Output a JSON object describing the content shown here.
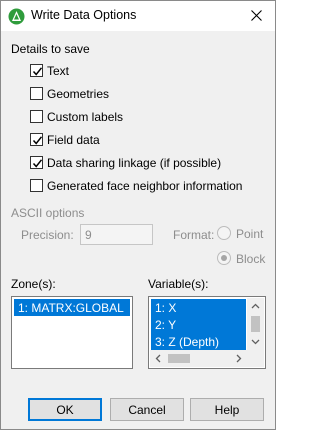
{
  "window": {
    "title": "Write Data Options",
    "icons": {
      "app": "tecplot-app-icon",
      "close": "close-icon"
    }
  },
  "details": {
    "heading": "Details to save",
    "options": [
      {
        "label": "Text",
        "checked": true
      },
      {
        "label": "Geometries",
        "checked": false
      },
      {
        "label": "Custom labels",
        "checked": false
      },
      {
        "label": "Field data",
        "checked": true
      },
      {
        "label": "Data sharing linkage (if possible)",
        "checked": true
      },
      {
        "label": "Generated face neighbor information",
        "checked": false
      }
    ]
  },
  "ascii": {
    "heading": "ASCII options",
    "precision_label": "Precision:",
    "precision_value": "9",
    "format_label": "Format:",
    "format_options": [
      "Point",
      "Block"
    ],
    "format_selected": "Block"
  },
  "zones": {
    "label": "Zone(s):",
    "items": [
      "1: MATRX:GLOBAL"
    ],
    "selected": [
      "1: MATRX:GLOBAL"
    ]
  },
  "variables": {
    "label": "Variable(s):",
    "items": [
      "1: X",
      "2: Y",
      "3: Z (Depth)"
    ],
    "selected": [
      "1: X",
      "2: Y",
      "3: Z (Depth)"
    ]
  },
  "buttons": {
    "ok": "OK",
    "cancel": "Cancel",
    "help": "Help"
  },
  "colors": {
    "selection": "#0078d7",
    "default_button_border": "#0078d7",
    "dialog_bg": "#f0f0f0"
  }
}
